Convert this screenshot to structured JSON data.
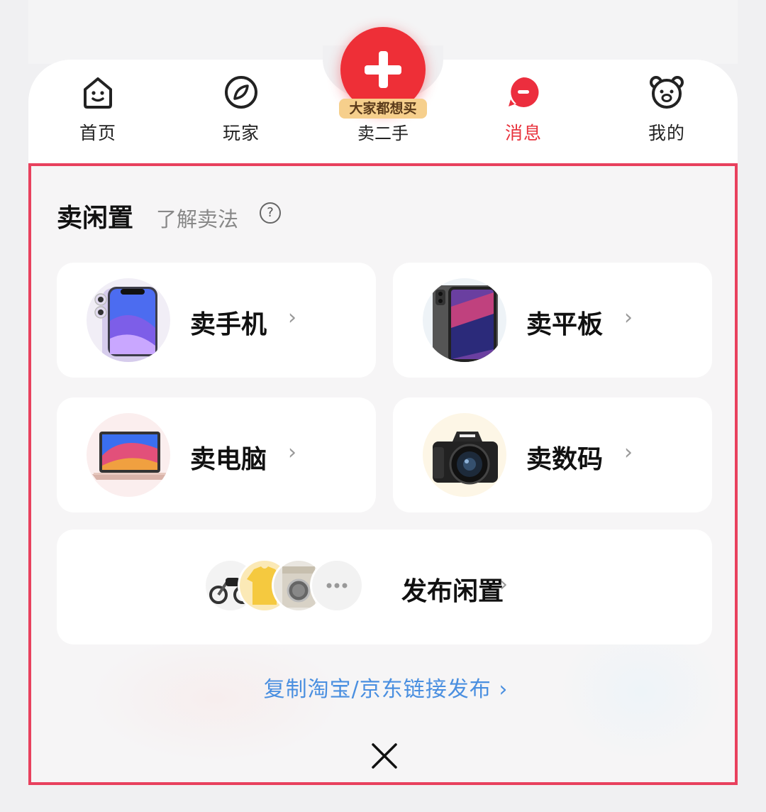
{
  "tabbar": {
    "tabs": [
      {
        "label": "首页",
        "icon": "home-face-icon"
      },
      {
        "label": "玩家",
        "icon": "compass-icon"
      },
      {
        "label": "卖二手",
        "icon": "plus-icon",
        "badge": "大家都想买"
      },
      {
        "label": "消息",
        "icon": "message-bubble-icon",
        "active": true
      },
      {
        "label": "我的",
        "icon": "bear-face-icon"
      }
    ]
  },
  "panel": {
    "title": "卖闲置",
    "subtitle": "了解卖法",
    "help_icon": "?",
    "cards": [
      {
        "label": "卖手机",
        "icon": "phone-image"
      },
      {
        "label": "卖平板",
        "icon": "tablet-image"
      },
      {
        "label": "卖电脑",
        "icon": "laptop-image"
      },
      {
        "label": "卖数码",
        "icon": "camera-image"
      }
    ],
    "publish": {
      "label": "发布闲置",
      "thumbs": [
        "motorcycle-image",
        "clothes-image",
        "washer-image",
        "more-icon"
      ]
    },
    "copy_link": "复制淘宝/京东链接发布 ›",
    "chevron": "›"
  },
  "colors": {
    "accent_red": "#ee2f37",
    "active_tab": "#e8323c",
    "link_blue": "#4a8fe0",
    "panel_border": "#e8415e",
    "badge_gold": "#f6cf8c"
  }
}
